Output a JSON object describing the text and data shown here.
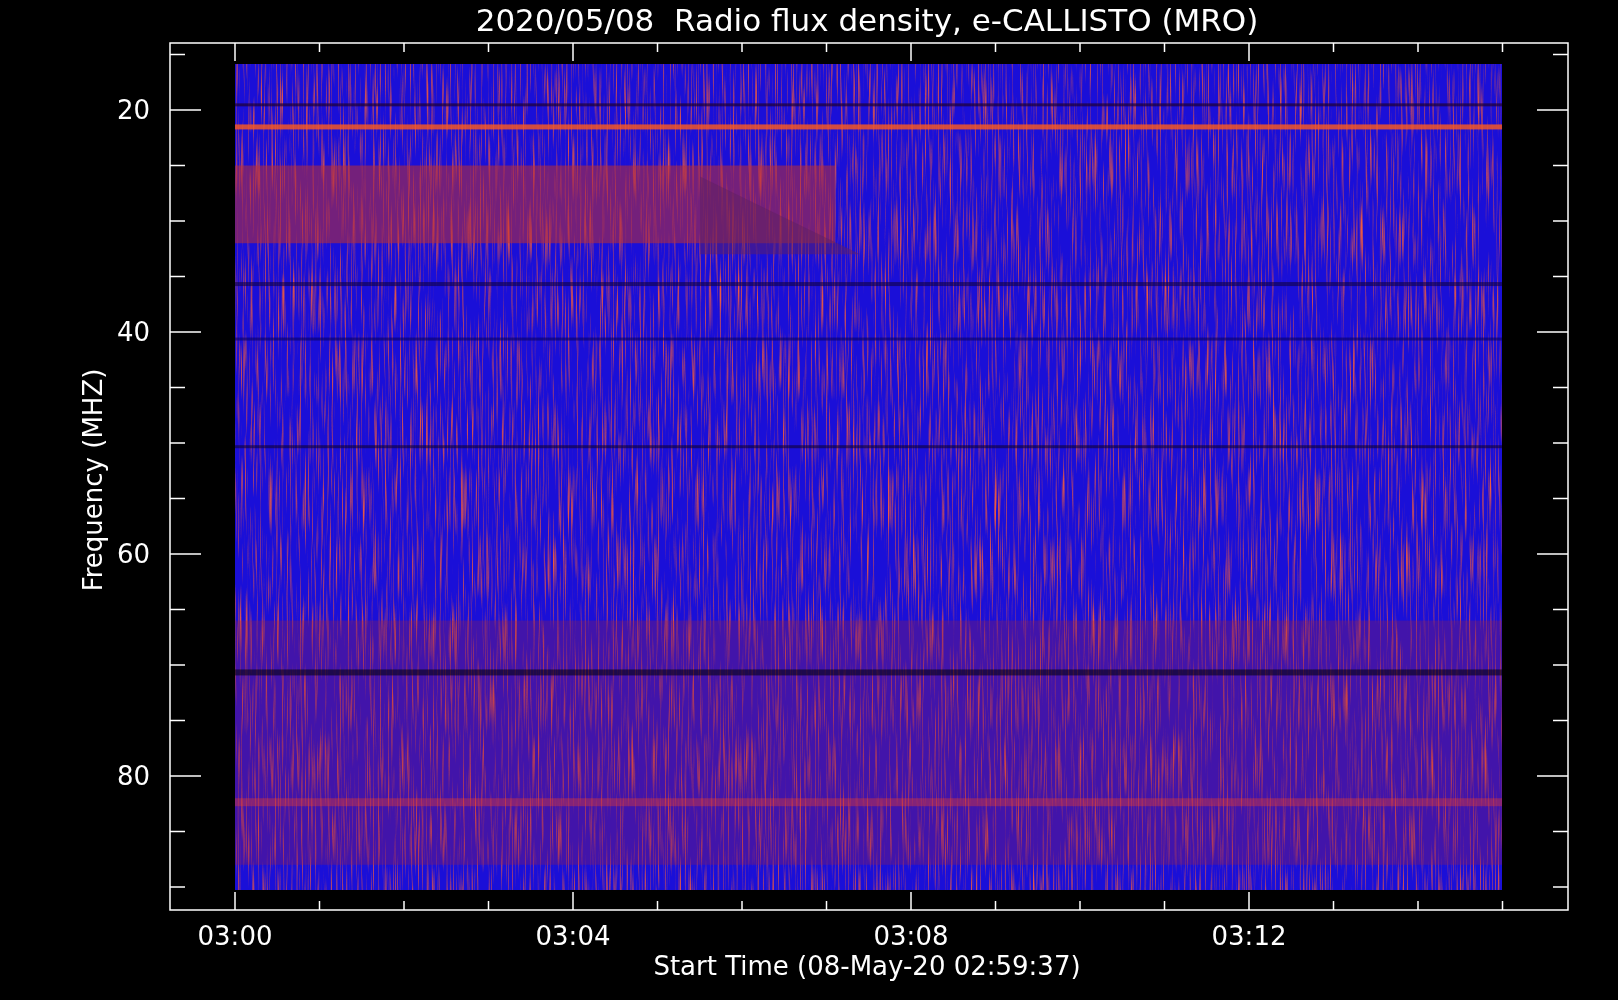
{
  "plot": {
    "title": "2020/05/08  Radio flux density, e-CALLISTO (MRO)",
    "xlabel": "Start Time (08-May-20 02:59:37)",
    "ylabel": "Frequency (MHZ)",
    "x_tick_labels": [
      "03:00",
      "03:04",
      "03:08",
      "03:12"
    ],
    "y_tick_labels": [
      "20",
      "40",
      "60",
      "80"
    ]
  }
}
